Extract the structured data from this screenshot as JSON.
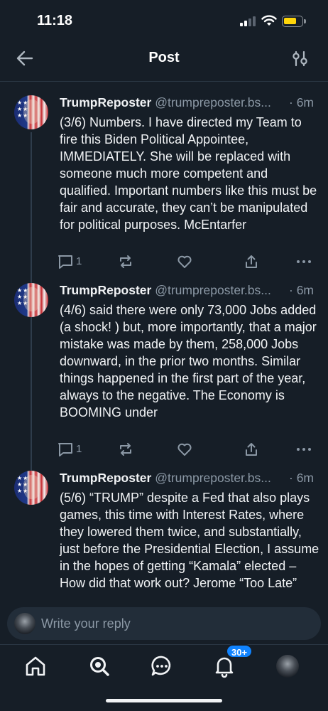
{
  "status_bar": {
    "time": "11:18"
  },
  "header": {
    "title": "Post"
  },
  "posts": [
    {
      "author": "TrumpReposter",
      "handle": "@trumpreposter.bs...",
      "time": "6m",
      "text": "(3/6) Numbers. I have directed my Team to fire this Biden Political Appointee, IMMEDIATELY. She will be replaced with someone much more competent and qualified. Important numbers like this must be fair and accurate, they can’t be manipulated for political purposes. McEntarfer",
      "reply_count": "1"
    },
    {
      "author": "TrumpReposter",
      "handle": "@trumpreposter.bs...",
      "time": "6m",
      "text": "(4/6) said there were only 73,000 Jobs added (a shock! ) but, more importantly, that a major mistake was made by them, 258,000 Jobs downward, in the prior two months. Similar things happened in the first part of the year, always to the negative. The Economy is BOOMING under",
      "reply_count": "1"
    },
    {
      "author": "TrumpReposter",
      "handle": "@trumpreposter.bs...",
      "time": "6m",
      "text": "(5/6) “TRUMP” despite a Fed that also plays games, this time with Interest Rates, where they lowered them twice, and substantially, just before the Presidential Election, I assume in the hopes of getting “Kamala” elected – How did that work out? Jerome “Too Late”"
    }
  ],
  "reply": {
    "placeholder": "Write your reply"
  },
  "nav": {
    "notifications_badge": "30+"
  },
  "colors": {
    "background": "#161e27",
    "accent": "#1083fe",
    "muted": "#8b98a5",
    "battery": "#ffd60a"
  }
}
